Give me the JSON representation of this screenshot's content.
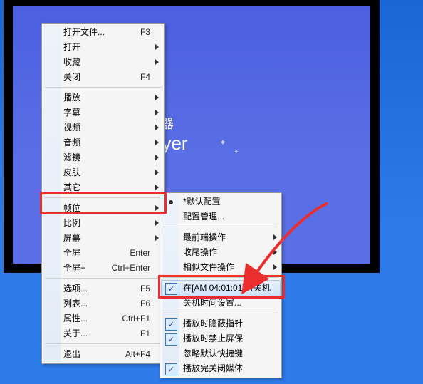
{
  "player": {
    "line1": "放器",
    "line2": "ayer"
  },
  "main_menu": {
    "items": [
      {
        "label": "打开文件...",
        "shortcut": "F3",
        "arrow": false
      },
      {
        "label": "打开",
        "shortcut": "",
        "arrow": true
      },
      {
        "label": "收藏",
        "shortcut": "",
        "arrow": true
      },
      {
        "label": "关闭",
        "shortcut": "F4",
        "arrow": false
      },
      {
        "sep": true
      },
      {
        "label": "播放",
        "shortcut": "",
        "arrow": true
      },
      {
        "label": "字幕",
        "shortcut": "",
        "arrow": true
      },
      {
        "label": "视频",
        "shortcut": "",
        "arrow": true
      },
      {
        "label": "音频",
        "shortcut": "",
        "arrow": true
      },
      {
        "label": "滤镜",
        "shortcut": "",
        "arrow": true
      },
      {
        "label": "皮肤",
        "shortcut": "",
        "arrow": true
      },
      {
        "label": "其它",
        "shortcut": "",
        "arrow": true,
        "is_hl": true
      },
      {
        "sep": true
      },
      {
        "label": "帧位",
        "shortcut": "",
        "arrow": true
      },
      {
        "label": "比例",
        "shortcut": "",
        "arrow": true
      },
      {
        "label": "屏幕",
        "shortcut": "",
        "arrow": true
      },
      {
        "label": "全屏",
        "shortcut": "Enter",
        "arrow": false
      },
      {
        "label": "全屏+",
        "shortcut": "Ctrl+Enter",
        "arrow": false
      },
      {
        "sep": true
      },
      {
        "label": "选项...",
        "shortcut": "F5",
        "arrow": false
      },
      {
        "label": "列表...",
        "shortcut": "F6",
        "arrow": false
      },
      {
        "label": "属性...",
        "shortcut": "Ctrl+F1",
        "arrow": false
      },
      {
        "label": "关于...",
        "shortcut": "F1",
        "arrow": false
      },
      {
        "sep": true
      },
      {
        "label": "退出",
        "shortcut": "Alt+F4",
        "arrow": false
      }
    ]
  },
  "sub_menu": {
    "items": [
      {
        "label": "*默认配置",
        "bullet": true
      },
      {
        "label": "配置管理..."
      },
      {
        "sep": true
      },
      {
        "label": "最前端操作",
        "arrow": true
      },
      {
        "label": "收尾操作",
        "arrow": true
      },
      {
        "label": "相似文件操作",
        "arrow": true
      },
      {
        "sep": true
      },
      {
        "label": "在[AM 04:01:01]时关机",
        "check": true,
        "highlight": true
      },
      {
        "label": "关机时间设置..."
      },
      {
        "sep": true
      },
      {
        "label": "播放时隐蔽指针",
        "check": true
      },
      {
        "label": "播放时禁止屏保",
        "check": true
      },
      {
        "label": "忽略默认快捷键"
      },
      {
        "label": "播放完关闭媒体",
        "check": true
      }
    ]
  }
}
